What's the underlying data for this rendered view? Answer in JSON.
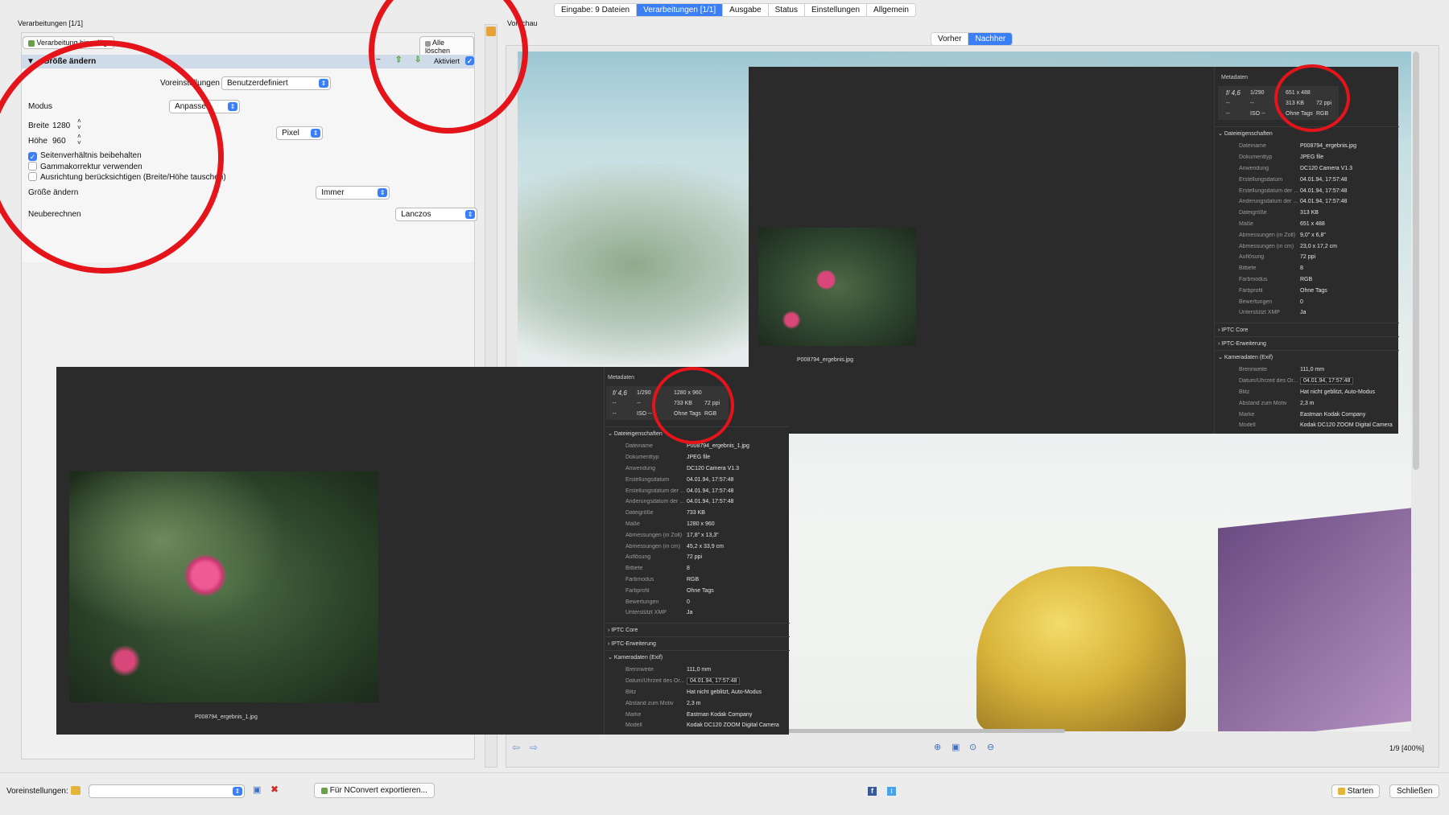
{
  "tabs": [
    {
      "label": "Eingabe: 9 Dateien",
      "active": false
    },
    {
      "label": "Verarbeitungen [1/1]",
      "active": true
    },
    {
      "label": "Ausgabe",
      "active": false
    },
    {
      "label": "Status",
      "active": false
    },
    {
      "label": "Einstellungen",
      "active": false
    },
    {
      "label": "Allgemein",
      "active": false
    }
  ],
  "left": {
    "title": "Verarbeitungen [1/1]",
    "add_label": "Verarbeitung hinzufügen",
    "clear_all": "Alle löschen",
    "section_title": "Größe ändern",
    "activated": "Aktiviert",
    "presets_label": "Voreinstellungen",
    "presets_value": "Benutzerdefiniert",
    "mode_label": "Modus",
    "mode_value": "Anpassen",
    "width_label": "Breite",
    "width_value": "1280",
    "height_label": "Höhe",
    "height_value": "960",
    "unit_value": "Pixel",
    "check_aspect": "Seitenverhältnis beibehalten",
    "check_gamma": "Gammakorrektur verwenden",
    "check_orient": "Ausrichtung berücksichtigen (Breite/Höhe tauschen)",
    "resize_label": "Größe ändern",
    "resize_value": "Immer",
    "resample_label": "Neuberechnen",
    "resample_value": "Lanczos"
  },
  "preview": {
    "title": "Vorschau",
    "before": "Vorher",
    "after": "Nachher",
    "status": "1/9 [400%]"
  },
  "meta_small": {
    "header": "Metadaten",
    "aperture": "f/ 4,6",
    "shutter": "1/290",
    "iso": "ISO --",
    "dash1": "--",
    "dash2": "--",
    "dash3": "--",
    "dims": "651 x 488",
    "size": "313 KB",
    "ppi": "72 ppi",
    "tags": "Ohne Tags",
    "mode": "RGB",
    "file_props": "Dateieigenschaften",
    "caption": "P008794_ergebnis.jpg",
    "rows": [
      {
        "k": "Dateiname",
        "v": "P008794_ergebnis.jpg"
      },
      {
        "k": "Dokumenttyp",
        "v": "JPEG file"
      },
      {
        "k": "Anwendung",
        "v": "DC120 Camera V1.3"
      },
      {
        "k": "Erstellungsdatum",
        "v": "04.01.94, 17:57:48"
      },
      {
        "k": "Erstellungsdatum der ...",
        "v": "04.01.94, 17:57:48"
      },
      {
        "k": "Änderungsdatum der ...",
        "v": "04.01.94, 17:57:48"
      },
      {
        "k": "Dateigröße",
        "v": "313 KB"
      },
      {
        "k": "Maße",
        "v": "651 x 488"
      },
      {
        "k": "Abmessungen (in Zoll)",
        "v": "9,0\" x 6,8\""
      },
      {
        "k": "Abmessungen (in cm)",
        "v": "23,0 x 17,2 cm"
      },
      {
        "k": "Auflösung",
        "v": "72 ppi"
      },
      {
        "k": "Bittiefe",
        "v": "8"
      },
      {
        "k": "Farbmodus",
        "v": "RGB"
      },
      {
        "k": "Farbprofil",
        "v": "Ohne Tags"
      },
      {
        "k": "Bewertungen",
        "v": "0"
      },
      {
        "k": "Unterstützt XMP",
        "v": "Ja"
      }
    ],
    "iptc_core": "IPTC Core",
    "iptc_ext": "IPTC-Erweiterung",
    "exif": "Kameradaten (Exif)",
    "exif_rows": [
      {
        "k": "Brennweite",
        "v": "111,0 mm"
      },
      {
        "k": "Datum/Uhrzeit des Or...",
        "v": "04.01.94, 17:57:48"
      },
      {
        "k": "Blitz",
        "v": "Hat nicht geblitzt, Auto-Modus"
      },
      {
        "k": "Abstand zum Motiv",
        "v": "2,3 m"
      },
      {
        "k": "Marke",
        "v": "Eastman Kodak Company"
      },
      {
        "k": "Modell",
        "v": "Kodak DC120 ZOOM Digital Camera"
      }
    ]
  },
  "meta_big": {
    "header": "Metadaten",
    "aperture": "f/ 4,6",
    "shutter": "1/290",
    "iso": "ISO --",
    "dash1": "--",
    "dash2": "--",
    "dash3": "--",
    "dims": "1280 x 960",
    "size": "733 KB",
    "ppi": "72 ppi",
    "tags": "Ohne Tags",
    "mode": "RGB",
    "file_props": "Dateieigenschaften",
    "caption": "P008794_ergebnis_1.jpg",
    "rows": [
      {
        "k": "Dateiname",
        "v": "P008794_ergebnis_1.jpg"
      },
      {
        "k": "Dokumenttyp",
        "v": "JPEG file"
      },
      {
        "k": "Anwendung",
        "v": "DC120 Camera V1.3"
      },
      {
        "k": "Erstellungsdatum",
        "v": "04.01.94, 17:57:48"
      },
      {
        "k": "Erstellungsdatum der ...",
        "v": "04.01.94, 17:57:48"
      },
      {
        "k": "Änderungsdatum der ...",
        "v": "04.01.94, 17:57:48"
      },
      {
        "k": "Dateigröße",
        "v": "733 KB"
      },
      {
        "k": "Maße",
        "v": "1280 x 960"
      },
      {
        "k": "Abmessungen (in Zoll)",
        "v": "17,8\" x 13,3\""
      },
      {
        "k": "Abmessungen (in cm)",
        "v": "45,2 x 33,9 cm"
      },
      {
        "k": "Auflösung",
        "v": "72 ppi"
      },
      {
        "k": "Bittiefe",
        "v": "8"
      },
      {
        "k": "Farbmodus",
        "v": "RGB"
      },
      {
        "k": "Farbprofil",
        "v": "Ohne Tags"
      },
      {
        "k": "Bewertungen",
        "v": "0"
      },
      {
        "k": "Unterstützt XMP",
        "v": "Ja"
      }
    ],
    "iptc_core": "IPTC Core",
    "iptc_ext": "IPTC-Erweiterung",
    "exif": "Kameradaten (Exif)",
    "exif_rows": [
      {
        "k": "Brennweite",
        "v": "111,0 mm"
      },
      {
        "k": "Datum/Uhrzeit des Or...",
        "v": "04.01.94, 17:57:48"
      },
      {
        "k": "Blitz",
        "v": "Hat nicht geblitzt, Auto-Modus"
      },
      {
        "k": "Abstand zum Motiv",
        "v": "2,3 m"
      },
      {
        "k": "Marke",
        "v": "Eastman Kodak Company"
      },
      {
        "k": "Modell",
        "v": "Kodak DC120 ZOOM Digital Camera"
      }
    ]
  },
  "bottom": {
    "presets_label": "Voreinstellungen:",
    "export": "Für NConvert exportieren...",
    "start": "Starten",
    "close": "Schließen"
  },
  "colors": {
    "accent": "#3a7ff6",
    "annotation": "#e4141a"
  },
  "icons": [
    "folder-icon",
    "save-icon",
    "delete-icon",
    "facebook-icon",
    "twitter-icon",
    "zoom-in-icon",
    "fit-icon",
    "zoom-actual-icon",
    "zoom-out-icon",
    "prev-arrow-icon",
    "next-arrow-icon"
  ]
}
